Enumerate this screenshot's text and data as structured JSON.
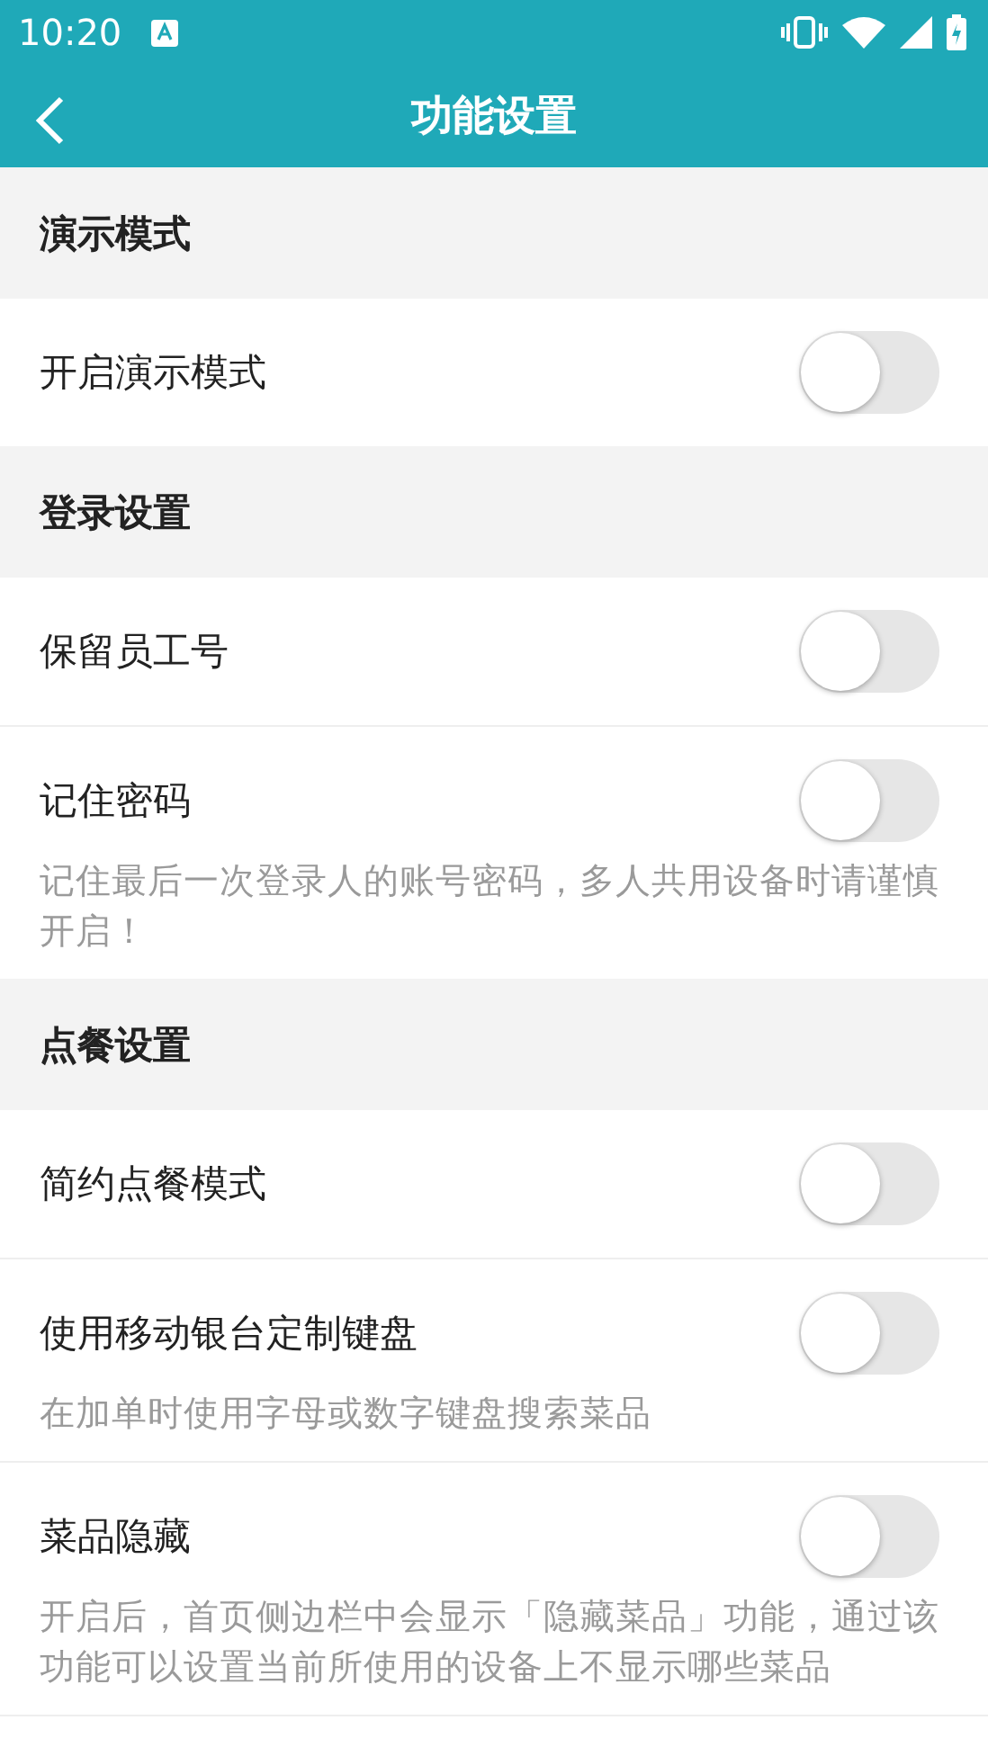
{
  "status_bar": {
    "time": "10:20"
  },
  "toolbar": {
    "title": "功能设置"
  },
  "sections": [
    {
      "title": "演示模式",
      "items": [
        {
          "label": "开启演示模式",
          "on": false
        }
      ]
    },
    {
      "title": "登录设置",
      "items": [
        {
          "label": "保留员工号",
          "on": false
        },
        {
          "label": "记住密码",
          "on": false,
          "description": "记住最后一次登录人的账号密码，多人共用设备时请谨慎开启！"
        }
      ]
    },
    {
      "title": "点餐设置",
      "items": [
        {
          "label": "简约点餐模式",
          "on": false
        },
        {
          "label": "使用移动银台定制键盘",
          "on": false,
          "description": "在加单时使用字母或数字键盘搜索菜品"
        },
        {
          "label": "菜品隐藏",
          "on": false,
          "description": "开启后，首页侧边栏中会显示「隐藏菜品」功能，通过该功能可以设置当前所使用的设备上不显示哪些菜品"
        }
      ]
    }
  ]
}
